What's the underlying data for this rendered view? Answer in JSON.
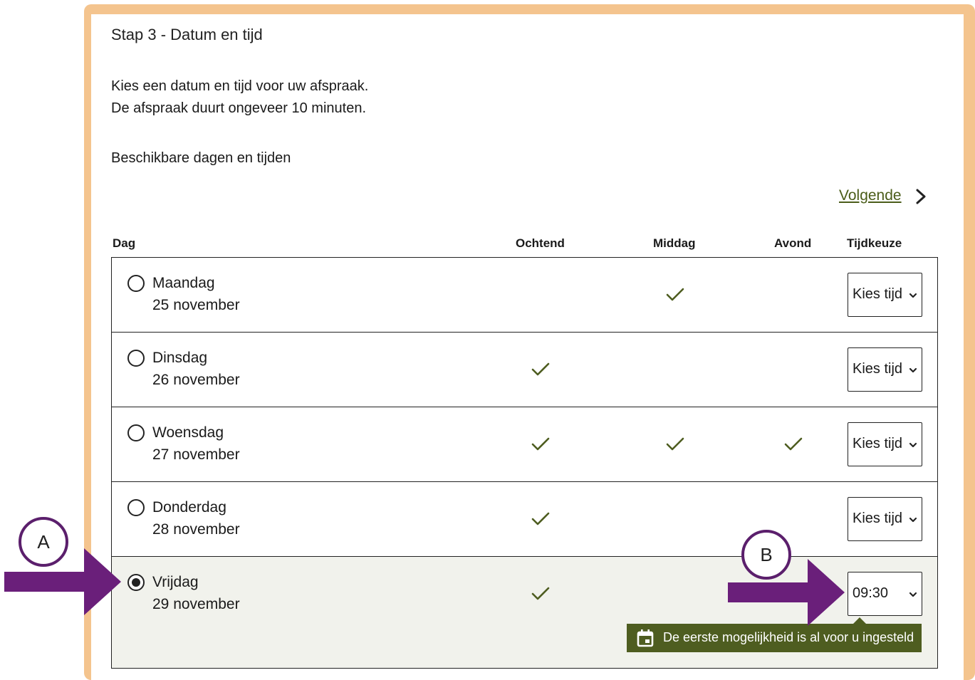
{
  "step_title": "Stap 3 - Datum en tijd",
  "intro_line1": "Kies een datum en tijd voor uw afspraak.",
  "intro_line2": "De afspraak duurt ongeveer 10 minuten.",
  "available_label": "Beschikbare dagen en tijden",
  "next_label": "Volgende",
  "columns": {
    "day": "Dag",
    "morning": "Ochtend",
    "afternoon": "Middag",
    "evening": "Avond",
    "time": "Tijdkeuze"
  },
  "rows": [
    {
      "day": "Maandag",
      "date": "25 november",
      "morning": false,
      "afternoon": true,
      "evening": false,
      "time": "Kies tijd",
      "selected": false
    },
    {
      "day": "Dinsdag",
      "date": "26 november",
      "morning": true,
      "afternoon": false,
      "evening": false,
      "time": "Kies tijd",
      "selected": false
    },
    {
      "day": "Woensdag",
      "date": "27 november",
      "morning": true,
      "afternoon": true,
      "evening": true,
      "time": "Kies tijd",
      "selected": false
    },
    {
      "day": "Donderdag",
      "date": "28 november",
      "morning": true,
      "afternoon": false,
      "evening": false,
      "time": "Kies tijd",
      "selected": false
    },
    {
      "day": "Vrijdag",
      "date": "29 november",
      "morning": true,
      "afternoon": false,
      "evening": false,
      "time": "09:30",
      "selected": true
    }
  ],
  "tooltip": "De eerste mogelijkheid is al voor u ingesteld",
  "annotations": {
    "a": "A",
    "b": "B"
  },
  "colors": {
    "frame": "#f4c48e",
    "accent_green": "#4e5d20",
    "annotation_purple": "#6a1f7a"
  },
  "icons": {
    "next": "chevron-right-icon",
    "check": "checkmark-icon",
    "select": "chevron-down-icon",
    "tooltip": "calendar-icon"
  }
}
